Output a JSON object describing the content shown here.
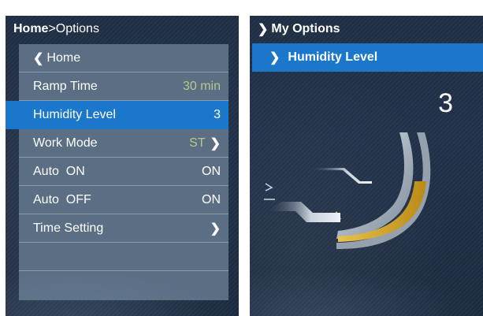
{
  "left": {
    "title_bold": "Home",
    "title_rest": ">Options",
    "menu": [
      {
        "label": "Home",
        "value": "",
        "chevron": false
      },
      {
        "label": "Ramp Time",
        "value": "30 min",
        "chevron": false
      },
      {
        "label": "Humidity Level",
        "value": "3",
        "chevron": false
      },
      {
        "label": "Work Mode",
        "value": "ST",
        "chevron": true
      },
      {
        "label": "Auto  ON",
        "value": "ON",
        "chevron": false
      },
      {
        "label": "Auto  OFF",
        "value": "ON",
        "chevron": false
      },
      {
        "label": "Time Setting",
        "value": "",
        "chevron": true
      }
    ],
    "selected_index": 2,
    "icons": {
      "back": "chevron-left-icon",
      "chevron": "chevron-right-icon"
    }
  },
  "right": {
    "title": "My Options",
    "selected_item": "Humidity Level",
    "humidity_value": "3",
    "humidity_level_fraction": 0.6,
    "colors": {
      "accent": "#1a77c9",
      "fill": "#f2c53a"
    }
  }
}
